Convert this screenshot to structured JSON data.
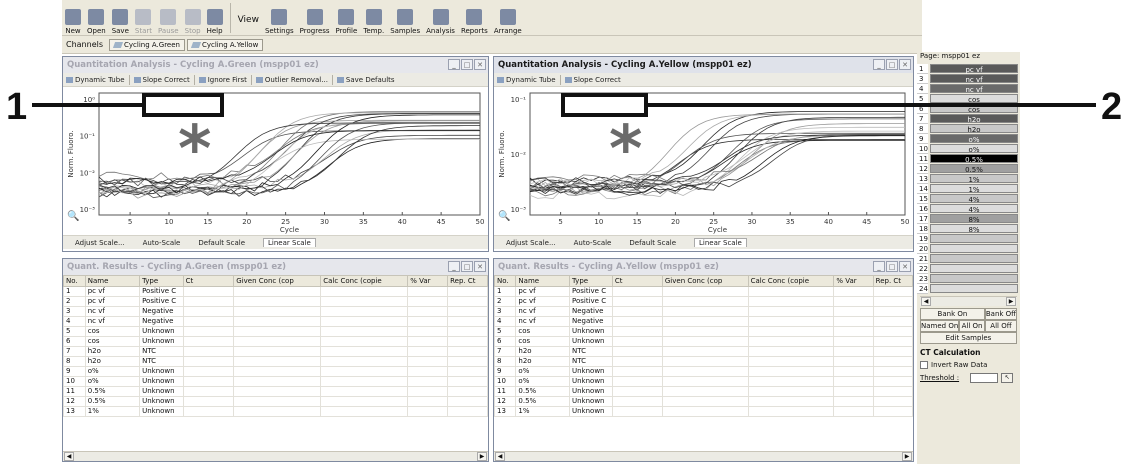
{
  "toolbar": {
    "buttons": [
      {
        "label": "New",
        "icon": "new-icon",
        "enabled": true
      },
      {
        "label": "Open",
        "icon": "open-icon",
        "enabled": true
      },
      {
        "label": "Save",
        "icon": "save-icon",
        "enabled": true
      },
      {
        "label": "Start",
        "icon": "play-icon",
        "enabled": false
      },
      {
        "label": "Pause",
        "icon": "pause-icon",
        "enabled": false
      },
      {
        "label": "Stop",
        "icon": "stop-icon",
        "enabled": false
      },
      {
        "label": "Help",
        "icon": "help-icon",
        "enabled": true
      }
    ],
    "view_label": "View",
    "view_buttons": [
      {
        "label": "Settings",
        "icon": "settings-icon"
      },
      {
        "label": "Progress",
        "icon": "progress-icon"
      },
      {
        "label": "Profile",
        "icon": "profile-icon"
      },
      {
        "label": "Temp.",
        "icon": "temp-icon"
      },
      {
        "label": "Samples",
        "icon": "samples-icon"
      },
      {
        "label": "Analysis",
        "icon": "analysis-icon"
      },
      {
        "label": "Reports",
        "icon": "reports-icon"
      },
      {
        "label": "Arrange",
        "icon": "arrange-icon"
      }
    ]
  },
  "channels": {
    "label": "Channels",
    "buttons": [
      "Cycling A.Green",
      "Cycling A.Yellow"
    ]
  },
  "green_panel": {
    "title": "Quantitation Analysis - Cycling A.Green (mspp01 ez)",
    "tools": [
      "Dynamic Tube",
      "Slope Correct",
      "Ignore First",
      "Outlier Removal...",
      "Save Defaults"
    ],
    "scale_buttons": [
      "Adjust Scale...",
      "Auto-Scale",
      "Default Scale",
      "Linear Scale"
    ]
  },
  "yellow_panel": {
    "title": "Quantitation Analysis - Cycling A.Yellow (mspp01 ez)",
    "tools": [
      "Dynamic Tube",
      "Slope Correct"
    ],
    "scale_buttons": [
      "Adjust Scale...",
      "Auto-Scale",
      "Default Scale",
      "Linear Scale"
    ]
  },
  "charts": {
    "ylabel": "Norm. Fluoro.",
    "xlabel": "Cycle",
    "xticks": [
      "5",
      "10",
      "15",
      "20",
      "25",
      "30",
      "35",
      "40",
      "45",
      "50"
    ],
    "green_yticks": [
      "10⁰",
      "10⁻¹",
      "10⁻²",
      "10⁻³"
    ],
    "yellow_yticks": [
      "10⁻¹",
      "10⁻²",
      "10⁻³"
    ]
  },
  "green_results": {
    "title": "Quant. Results - Cycling A.Green (mspp01 ez)",
    "columns": [
      "No.",
      "Name",
      "Type",
      "Ct",
      "Given Conc (cop",
      "Calc Conc (copie",
      "% Var",
      "Rep. Ct"
    ],
    "rows": [
      [
        "1",
        "pc vf",
        "Positive C"
      ],
      [
        "2",
        "pc vf",
        "Positive C"
      ],
      [
        "3",
        "nc vf",
        "Negative"
      ],
      [
        "4",
        "nc vf",
        "Negative"
      ],
      [
        "5",
        "cos",
        "Unknown"
      ],
      [
        "6",
        "cos",
        "Unknown"
      ],
      [
        "7",
        "h2o",
        "NTC"
      ],
      [
        "8",
        "h2o",
        "NTC"
      ],
      [
        "9",
        "o%",
        "Unknown"
      ],
      [
        "10",
        "o%",
        "Unknown"
      ],
      [
        "11",
        "0.5%",
        "Unknown"
      ],
      [
        "12",
        "0.5%",
        "Unknown"
      ],
      [
        "13",
        "1%",
        "Unknown"
      ]
    ]
  },
  "yellow_results": {
    "title": "Quant. Results - Cycling A.Yellow (mspp01 ez)",
    "columns": [
      "No.",
      "Name",
      "Type",
      "Ct",
      "Given Conc (cop",
      "Calc Conc (copie",
      "% Var",
      "Rep. Ct"
    ],
    "rows": [
      [
        "1",
        "pc vf",
        "Positive C"
      ],
      [
        "2",
        "pc vf",
        "Positive C"
      ],
      [
        "3",
        "nc vf",
        "Negative"
      ],
      [
        "4",
        "nc vf",
        "Negative"
      ],
      [
        "5",
        "cos",
        "Unknown"
      ],
      [
        "6",
        "cos",
        "Unknown"
      ],
      [
        "7",
        "h2o",
        "NTC"
      ],
      [
        "8",
        "h2o",
        "NTC"
      ],
      [
        "9",
        "o%",
        "Unknown"
      ],
      [
        "10",
        "o%",
        "Unknown"
      ],
      [
        "11",
        "0.5%",
        "Unknown"
      ],
      [
        "12",
        "0.5%",
        "Unknown"
      ],
      [
        "13",
        "1%",
        "Unknown"
      ]
    ]
  },
  "samples_panel": {
    "page_label": "Page: mspp01 ez",
    "rows": [
      {
        "n": "1",
        "name": "pc vf",
        "color": "#5a5a5a"
      },
      {
        "n": "3",
        "name": "nc vf",
        "color": "#5a5a5a"
      },
      {
        "n": "4",
        "name": "nc vf",
        "color": "#6a6a6a"
      },
      {
        "n": "5",
        "name": "cos",
        "color": "#dcdcdc"
      },
      {
        "n": "6",
        "name": "cos",
        "color": "#c8c8c8"
      },
      {
        "n": "7",
        "name": "h2o",
        "color": "#5a5a5a"
      },
      {
        "n": "8",
        "name": "h2o",
        "color": "#c8c8c8"
      },
      {
        "n": "9",
        "name": "o%",
        "color": "#6a6a6a"
      },
      {
        "n": "10",
        "name": "o%",
        "color": "#dcdcdc"
      },
      {
        "n": "11",
        "name": "0.5%",
        "color": "#000000"
      },
      {
        "n": "12",
        "name": "0.5%",
        "color": "#a0a0a0"
      },
      {
        "n": "13",
        "name": "1%",
        "color": "#c8c8c8"
      },
      {
        "n": "14",
        "name": "1%",
        "color": "#dcdcdc"
      },
      {
        "n": "15",
        "name": "4%",
        "color": "#c8c8c8"
      },
      {
        "n": "16",
        "name": "4%",
        "color": "#dcdcdc"
      },
      {
        "n": "17",
        "name": "8%",
        "color": "#a0a0a0"
      },
      {
        "n": "18",
        "name": "8%",
        "color": "#dcdcdc"
      },
      {
        "n": "19",
        "name": "",
        "color": "#c8c8c8"
      },
      {
        "n": "20",
        "name": "",
        "color": "#dcdcdc"
      },
      {
        "n": "21",
        "name": "",
        "color": "#c8c8c8"
      },
      {
        "n": "22",
        "name": "",
        "color": "#dcdcdc"
      },
      {
        "n": "23",
        "name": "",
        "color": "#c8c8c8"
      },
      {
        "n": "24",
        "name": "",
        "color": "#dcdcdc"
      }
    ],
    "bank_buttons": [
      "Bank On",
      "Bank Off",
      "Named On",
      "All On",
      "All Off",
      "Edit Samples"
    ],
    "ct_title": "CT Calculation",
    "invert_label": "Invert Raw Data",
    "threshold_label": "Threshold :"
  },
  "callouts": {
    "one": "1",
    "two": "2",
    "asterisk": "*"
  }
}
